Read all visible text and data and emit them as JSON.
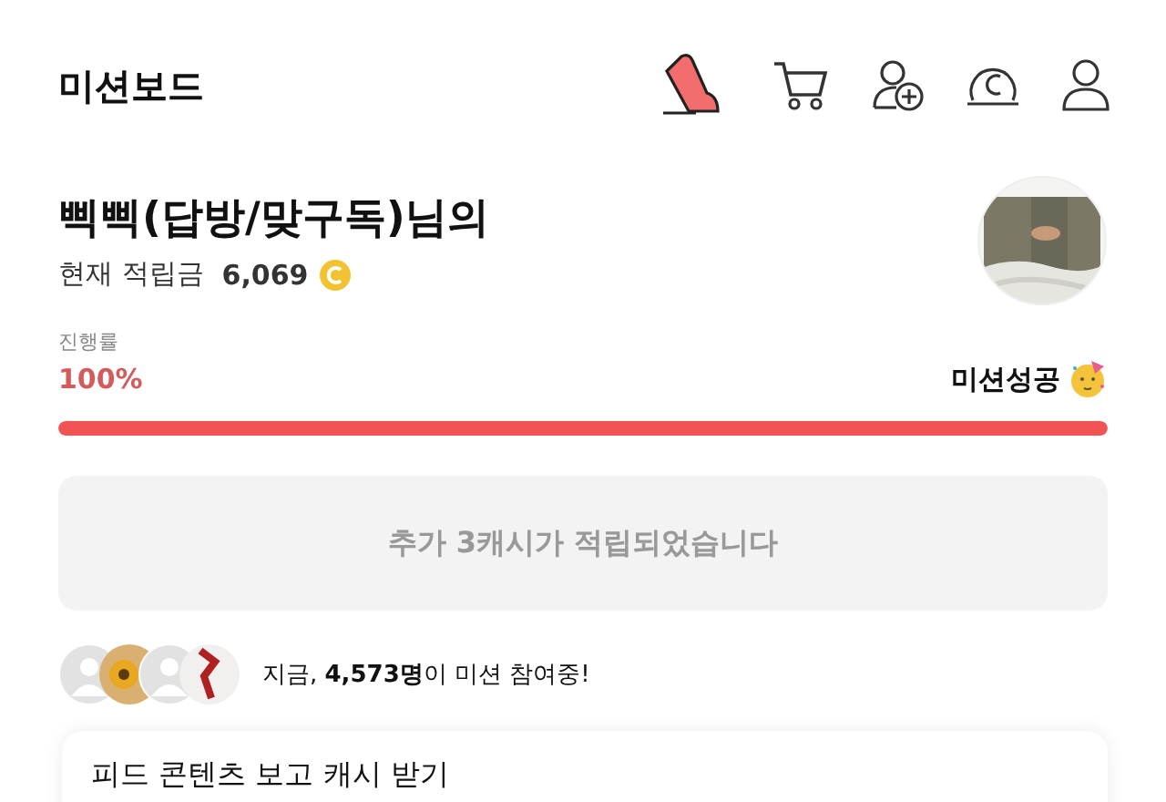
{
  "header": {
    "title": "미션보드",
    "icons": [
      {
        "kind": "shoe"
      },
      {
        "kind": "cart"
      },
      {
        "kind": "add-user"
      },
      {
        "kind": "coin"
      },
      {
        "kind": "user"
      }
    ]
  },
  "profile": {
    "name": "삑삑(답방/맞구독)님의",
    "points_label": "현재 적립금",
    "points": "6,069",
    "avatar": {
      "kind": "picture"
    }
  },
  "progress": {
    "label": "진행률",
    "percent": "100%",
    "level": 1,
    "status": "미션성공"
  },
  "notice": "추가 3캐시가 적립되었습니다",
  "participants": {
    "avatars": [
      {
        "kind": "person"
      },
      {
        "kind": "picture"
      },
      {
        "kind": "person"
      },
      {
        "kind": "picture"
      }
    ],
    "text": "지금, **4,573명**이 미션 참여중!"
  },
  "card": {
    "title": "피드 콘텐츠 보고 캐시 받기"
  }
}
